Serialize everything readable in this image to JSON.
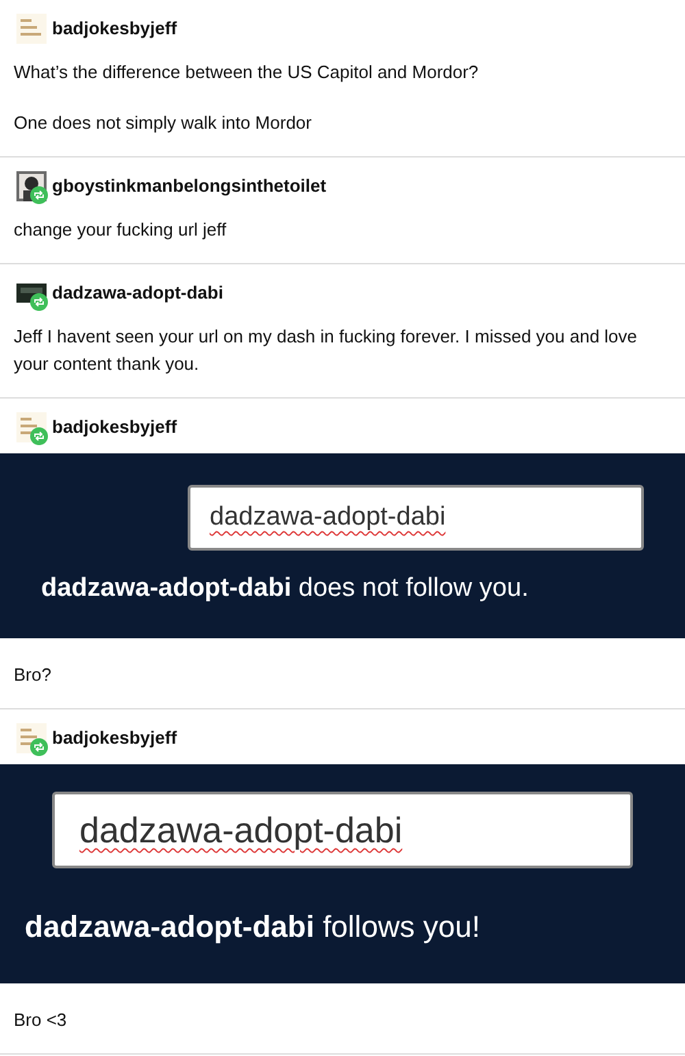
{
  "posts": [
    {
      "username": "badjokesbyjeff",
      "reblog": false,
      "body": [
        {
          "kind": "text",
          "text": "What’s the difference between the US Capitol and Mordor?"
        },
        {
          "kind": "text",
          "text": "One does not simply walk into Mordor"
        }
      ]
    },
    {
      "username": "gboystinkmanbelongsinthetoilet",
      "reblog": true,
      "body": [
        {
          "kind": "text",
          "text": "change your fucking url jeff"
        }
      ]
    },
    {
      "username": "dadzawa-adopt-dabi",
      "reblog": true,
      "body": [
        {
          "kind": "text",
          "text": "Jeff I havent seen your url on my dash in fucking forever. I missed you and love your content thank you."
        }
      ]
    },
    {
      "username": "badjokesbyjeff",
      "reblog": true,
      "body": [
        {
          "kind": "screenshot",
          "field_value": "dadzawa-adopt-dabi",
          "result": "**dadzawa-adopt-dabi** does not follow you."
        },
        {
          "kind": "text",
          "text": "Bro?"
        }
      ]
    },
    {
      "username": "badjokesbyjeff",
      "reblog": true,
      "body": [
        {
          "kind": "screenshot",
          "field_value": "dadzawa-adopt-dabi",
          "result": "**dadzawa-adopt-dabi** follows you!"
        },
        {
          "kind": "text",
          "text": "Bro <3"
        }
      ]
    }
  ]
}
